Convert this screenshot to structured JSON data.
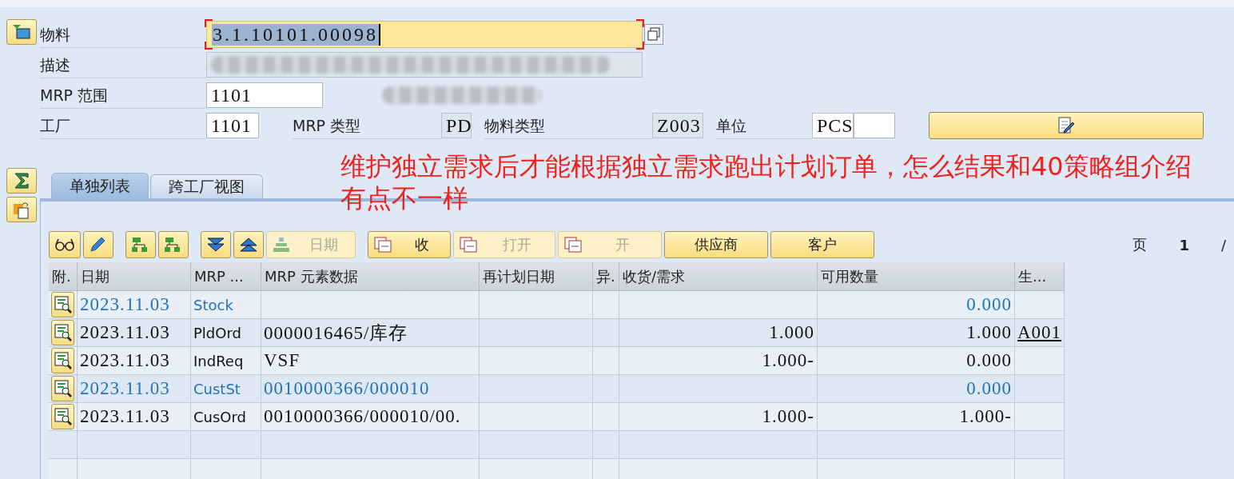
{
  "header": {
    "fields": [
      {
        "label": "物料",
        "value": "3.1.10101.00098",
        "kind": "focused"
      },
      {
        "label": "描述",
        "kind": "redacted"
      },
      {
        "label": "MRP 范围",
        "value": "1101",
        "kind": "input"
      }
    ],
    "plant_row": {
      "label": "工厂",
      "value": "1101",
      "mrp_type_label": "MRP 类型",
      "mrp_type": "PD",
      "material_type_label": "物料类型",
      "material_type": "Z003",
      "unit_label": "单位",
      "unit": "PCS"
    }
  },
  "annotation": "维护独立需求后才能根据独立需求跑出计划订单，怎么结果和40策略组介绍有点不一样",
  "tabs": [
    {
      "label": "单独列表",
      "selected": true
    },
    {
      "label": "跨工厂视图",
      "selected": false
    }
  ],
  "toolbar": [
    {
      "kind": "glasses",
      "disabled": false
    },
    {
      "kind": "pencil",
      "disabled": false
    },
    {
      "kind": "tree-up",
      "disabled": false
    },
    {
      "kind": "tree-down",
      "disabled": false
    },
    {
      "kind": "collapse",
      "disabled": false
    },
    {
      "kind": "expand",
      "disabled": false
    },
    {
      "kind": "text",
      "label": "日期",
      "disabled": true
    },
    {
      "kind": "text",
      "label": "收",
      "disabled": false
    },
    {
      "kind": "text",
      "label": "打开",
      "disabled": true
    },
    {
      "kind": "text",
      "label": "开",
      "disabled": true
    },
    {
      "kind": "plain",
      "label": "供应商",
      "disabled": false
    },
    {
      "kind": "plain",
      "label": "客户",
      "disabled": false
    }
  ],
  "page": {
    "label": "页",
    "number": "1",
    "separator": "/"
  },
  "table": {
    "columns": [
      "附.",
      "日期",
      "MRP ...",
      "MRP 元素数据",
      "再计划日期",
      "异.",
      "收货/需求",
      "可用数量",
      "生..."
    ],
    "rows": [
      {
        "kind": "total",
        "date": "2023.11.03",
        "element": "Stock",
        "data": "",
        "receipt": "",
        "available": "0.000",
        "supplier": ""
      },
      {
        "kind": "element",
        "date": "2023.11.03",
        "element": "PldOrd",
        "data": "0000016465/库存",
        "receipt": "1.000",
        "available": "1.000",
        "supplier": "A001"
      },
      {
        "kind": "element",
        "date": "2023.11.03",
        "element": "IndReq",
        "data": "VSF",
        "receipt": "1.000-",
        "available": "0.000",
        "supplier": ""
      },
      {
        "kind": "total",
        "date": "2023.11.03",
        "element": "CustSt",
        "data": "0010000366/000010",
        "receipt": "",
        "available": "0.000",
        "supplier": ""
      },
      {
        "kind": "element",
        "date": "2023.11.03",
        "element": "CusOrd",
        "data": "0010000366/000010/00.",
        "receipt": "1.000-",
        "available": "1.000-",
        "supplier": ""
      }
    ]
  }
}
